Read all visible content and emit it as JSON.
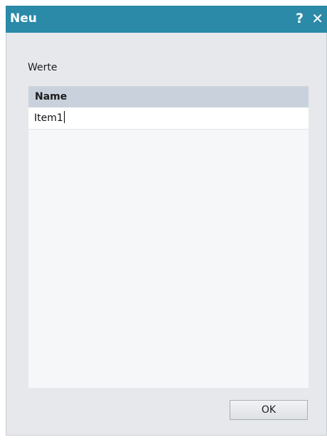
{
  "dialog": {
    "title": "Neu",
    "help_label": "?",
    "close_label": "✕"
  },
  "group": {
    "label": "Werte"
  },
  "list": {
    "column_header": "Name",
    "rows": [
      {
        "name": "Item1"
      }
    ]
  },
  "buttons": {
    "ok_label": "OK"
  },
  "colors": {
    "titlebar": "#2a8aa8",
    "dialog_bg": "#e6e8ec",
    "header_bg": "#c9d2dc"
  }
}
